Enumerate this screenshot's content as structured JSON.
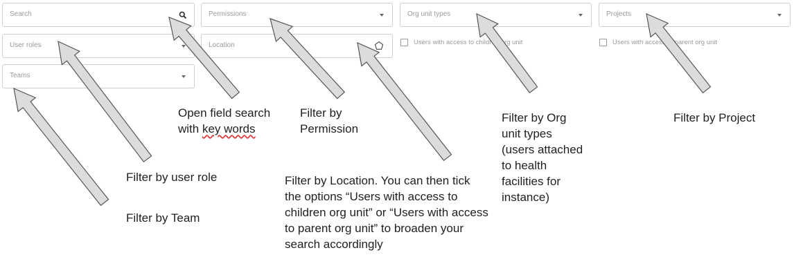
{
  "filters": {
    "search": {
      "placeholder": "Search",
      "icon": "search-icon"
    },
    "permissions": {
      "placeholder": "Permissions"
    },
    "org_unit_types": {
      "placeholder": "Org unit types"
    },
    "projects": {
      "placeholder": "Projects"
    },
    "user_roles": {
      "placeholder": "User roles"
    },
    "location": {
      "placeholder": "Location",
      "icon": "pentagon-icon"
    },
    "teams": {
      "placeholder": "Teams"
    },
    "children_checkbox": {
      "label": "Users with access to children org unit",
      "checked": false
    },
    "parent_checkbox": {
      "label": "Users with access to parent org unit",
      "checked": false
    }
  },
  "annotations": {
    "search": [
      "Open field search",
      "with ",
      "key words"
    ],
    "permission": [
      "Filter by",
      "Permission"
    ],
    "org_unit_types": [
      "Filter by Org",
      "unit types",
      "(users attached",
      "to health",
      "facilities for",
      "instance)"
    ],
    "project": [
      "Filter by Project"
    ],
    "user_role": [
      "Filter by user role"
    ],
    "team": [
      "Filter by Team"
    ],
    "location": [
      "Filter by Location. You can then tick",
      "the options “Users with access to",
      "children org unit” or “Users with access",
      "to parent org unit” to broaden your",
      "search accordingly"
    ]
  }
}
